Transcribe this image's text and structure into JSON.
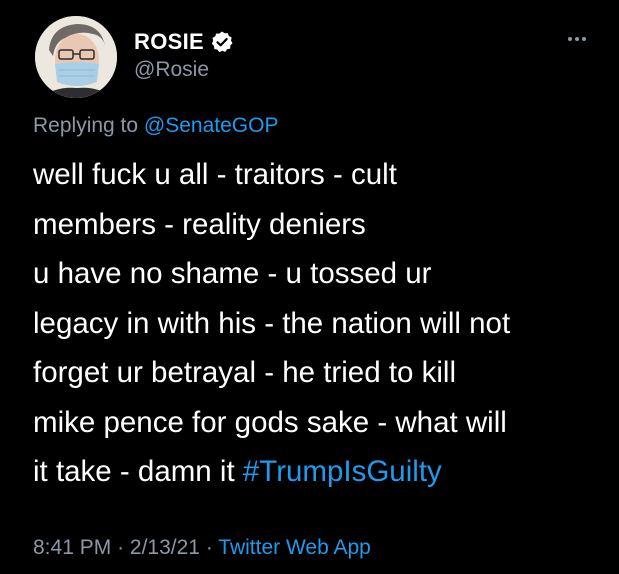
{
  "user": {
    "display_name": "ROSIE",
    "handle": "@Rosie",
    "verified": true,
    "avatar_icon": "user-avatar-masked"
  },
  "reply": {
    "prefix": "Replying to",
    "mention": "@SenateGOP"
  },
  "tweet": {
    "lines": [
      "well fuck u all - traitors - cult",
      "members - reality deniers",
      "u have no shame - u tossed ur",
      "legacy in with his - the nation will not",
      "forget ur betrayal - he tried to kill",
      "mike pence for gods sake - what will",
      "it take - damn it"
    ],
    "hashtag": "#TrumpIsGuilty"
  },
  "meta": {
    "time": "8:41 PM",
    "separator": "·",
    "date": "2/13/21",
    "app": "Twitter Web App"
  },
  "colors": {
    "background": "#000000",
    "accent": "#1d9bf0",
    "secondary_text": "#8b98a5",
    "primary_text": "#ffffff"
  },
  "icons": {
    "verified": "verified-badge-icon",
    "more": "more-options-icon"
  }
}
